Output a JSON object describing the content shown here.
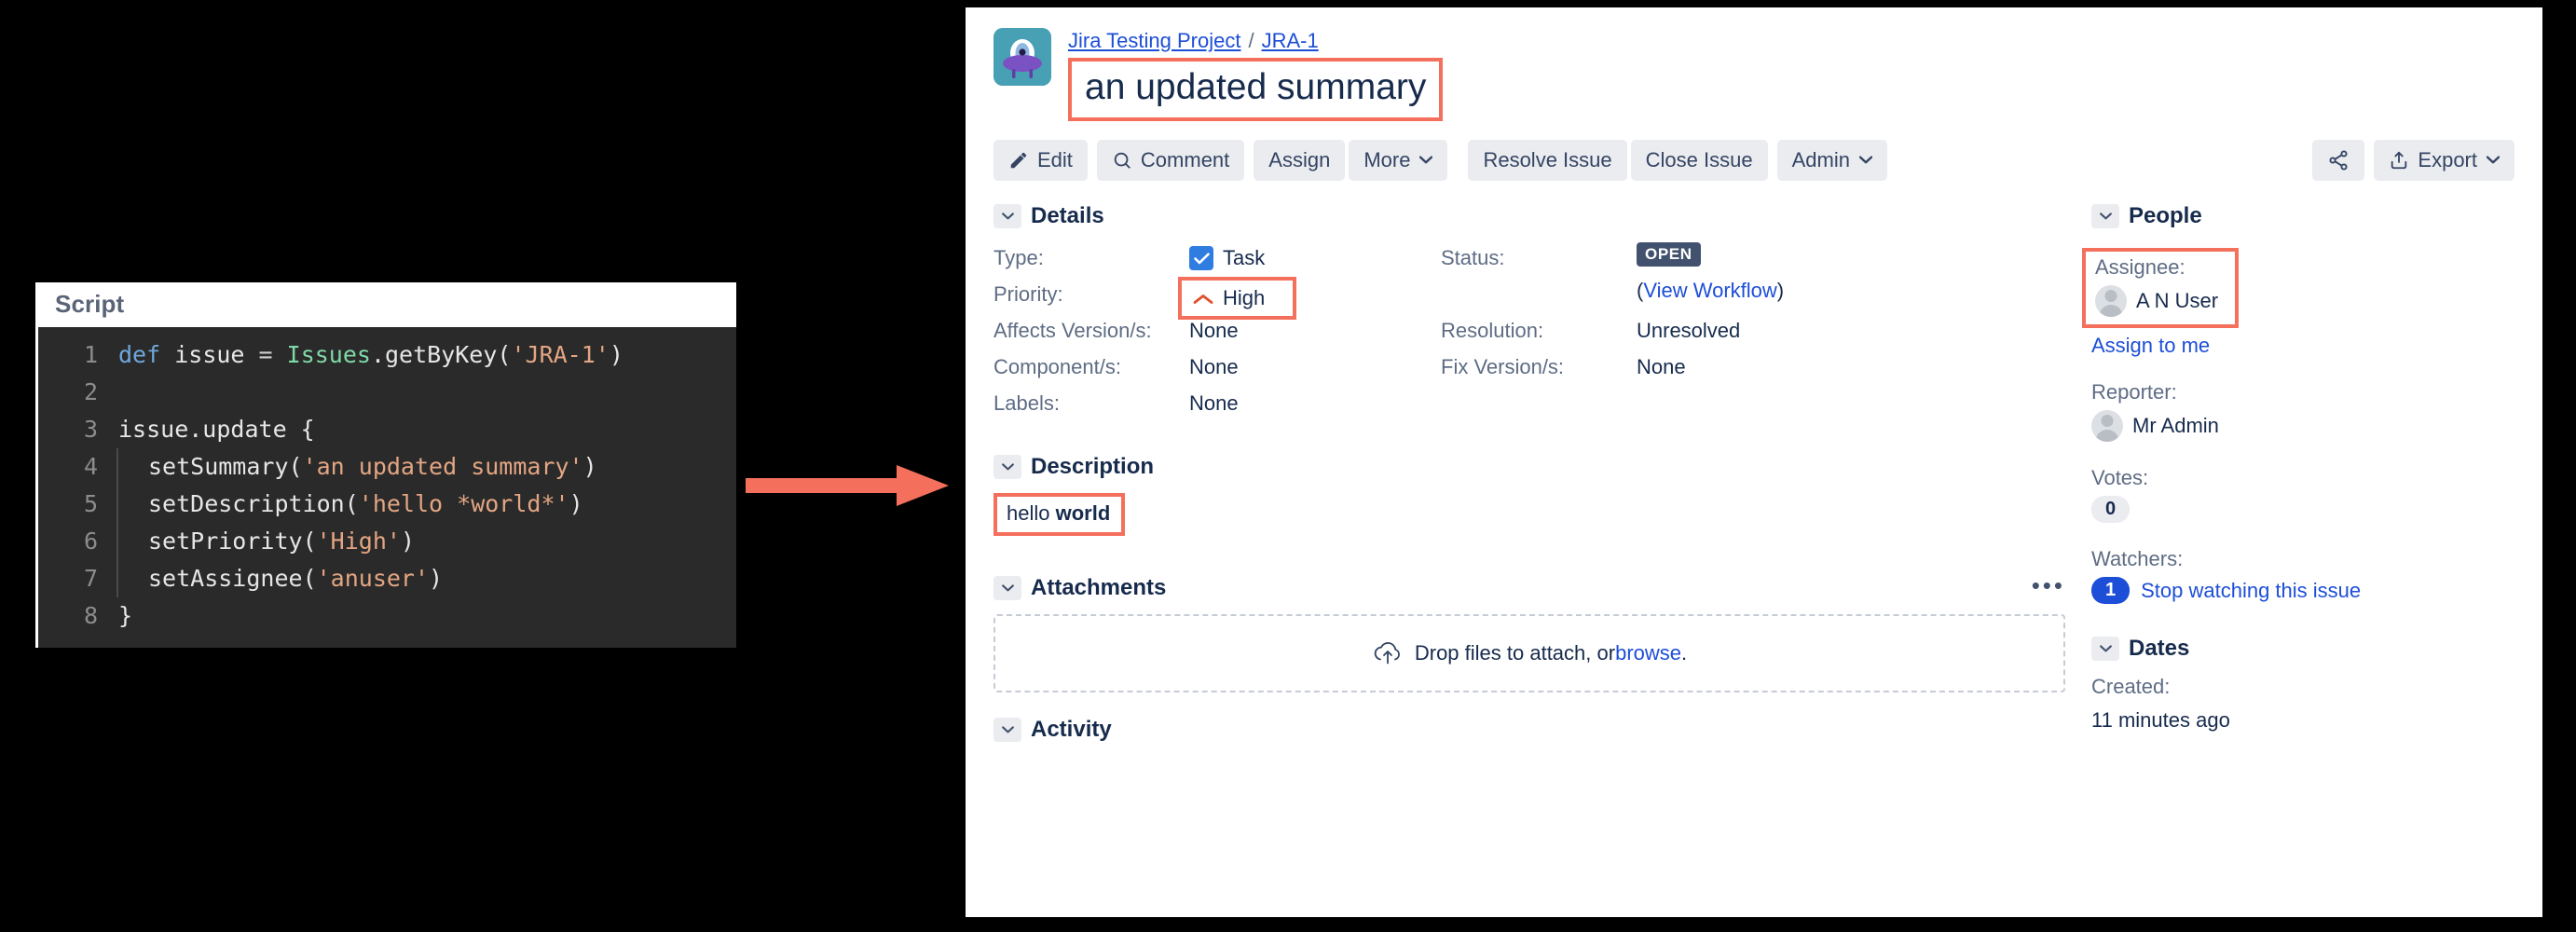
{
  "script_panel": {
    "title": "Script",
    "lines": [
      {
        "n": "1",
        "indented": false,
        "tokens": [
          {
            "t": "def ",
            "c": "kw"
          },
          {
            "t": "issue ",
            "c": "plain"
          },
          {
            "t": "= ",
            "c": "op"
          },
          {
            "t": "Issues",
            "c": "cls"
          },
          {
            "t": ".getByKey(",
            "c": "plain"
          },
          {
            "t": "'JRA-1'",
            "c": "str"
          },
          {
            "t": ")",
            "c": "plain"
          }
        ]
      },
      {
        "n": "2",
        "indented": false,
        "tokens": []
      },
      {
        "n": "3",
        "indented": false,
        "tokens": [
          {
            "t": "issue.update {",
            "c": "plain"
          }
        ]
      },
      {
        "n": "4",
        "indented": true,
        "tokens": [
          {
            "t": "setSummary(",
            "c": "plain"
          },
          {
            "t": "'an updated summary'",
            "c": "str"
          },
          {
            "t": ")",
            "c": "plain"
          }
        ]
      },
      {
        "n": "5",
        "indented": true,
        "tokens": [
          {
            "t": "setDescription(",
            "c": "plain"
          },
          {
            "t": "'hello *world*'",
            "c": "str"
          },
          {
            "t": ")",
            "c": "plain"
          }
        ]
      },
      {
        "n": "6",
        "indented": true,
        "tokens": [
          {
            "t": "setPriority(",
            "c": "plain"
          },
          {
            "t": "'High'",
            "c": "str"
          },
          {
            "t": ")",
            "c": "plain"
          }
        ]
      },
      {
        "n": "7",
        "indented": true,
        "tokens": [
          {
            "t": "setAssignee(",
            "c": "plain"
          },
          {
            "t": "'anuser'",
            "c": "str"
          },
          {
            "t": ")",
            "c": "plain"
          }
        ]
      },
      {
        "n": "8",
        "indented": false,
        "tokens": [
          {
            "t": "}",
            "c": "plain"
          }
        ]
      }
    ]
  },
  "jira": {
    "breadcrumb": {
      "project": "Jira Testing Project",
      "separator": "/",
      "issue_key": "JRA-1"
    },
    "summary": "an updated summary",
    "toolbar": {
      "edit": "Edit",
      "comment": "Comment",
      "assign": "Assign",
      "more": "More",
      "resolve": "Resolve Issue",
      "close": "Close Issue",
      "admin": "Admin",
      "export": "Export",
      "share_icon": "share-icon",
      "export_icon": "export-icon",
      "caret": "⌄"
    },
    "details": {
      "section_title": "Details",
      "left": [
        {
          "label": "Type:",
          "value": "Task"
        },
        {
          "label": "Priority:",
          "value": "High"
        },
        {
          "label": "Affects Version/s:",
          "value": "None"
        },
        {
          "label": "Component/s:",
          "value": "None"
        },
        {
          "label": "Labels:",
          "value": "None"
        }
      ],
      "right": [
        {
          "label": "Status:",
          "value": "OPEN"
        },
        {
          "label": "",
          "value": "View Workflow"
        },
        {
          "label": "Resolution:",
          "value": "Unresolved"
        },
        {
          "label": "Fix Version/s:",
          "value": "None"
        }
      ],
      "workflow_open_paren": "(",
      "workflow_close_paren": ")"
    },
    "description": {
      "section_title": "Description",
      "text_plain": "hello ",
      "text_bold": "world"
    },
    "attachments": {
      "section_title": "Attachments",
      "menu": "•••",
      "drop_text": "Drop files to attach, or ",
      "browse_link": "browse",
      "drop_period": "."
    },
    "activity": {
      "section_title": "Activity"
    },
    "people": {
      "section_title": "People",
      "assignee_label": "Assignee:",
      "assignee_name": "A N User",
      "assign_to_me": "Assign to me",
      "reporter_label": "Reporter:",
      "reporter_name": "Mr Admin",
      "votes_label": "Votes:",
      "votes_count": "0",
      "watchers_label": "Watchers:",
      "watchers_count": "1",
      "watch_link": "Stop watching this issue"
    },
    "dates": {
      "section_title": "Dates",
      "created_label": "Created:",
      "created_value": "11 minutes ago"
    }
  },
  "colors": {
    "accent_highlight": "#f4705d",
    "link_blue": "#1d4ed8",
    "status_grey": "#42526e",
    "priority_orange": "#e0502a",
    "type_blue": "#2f7de1",
    "watchers_blue": "#1d4ed8"
  }
}
